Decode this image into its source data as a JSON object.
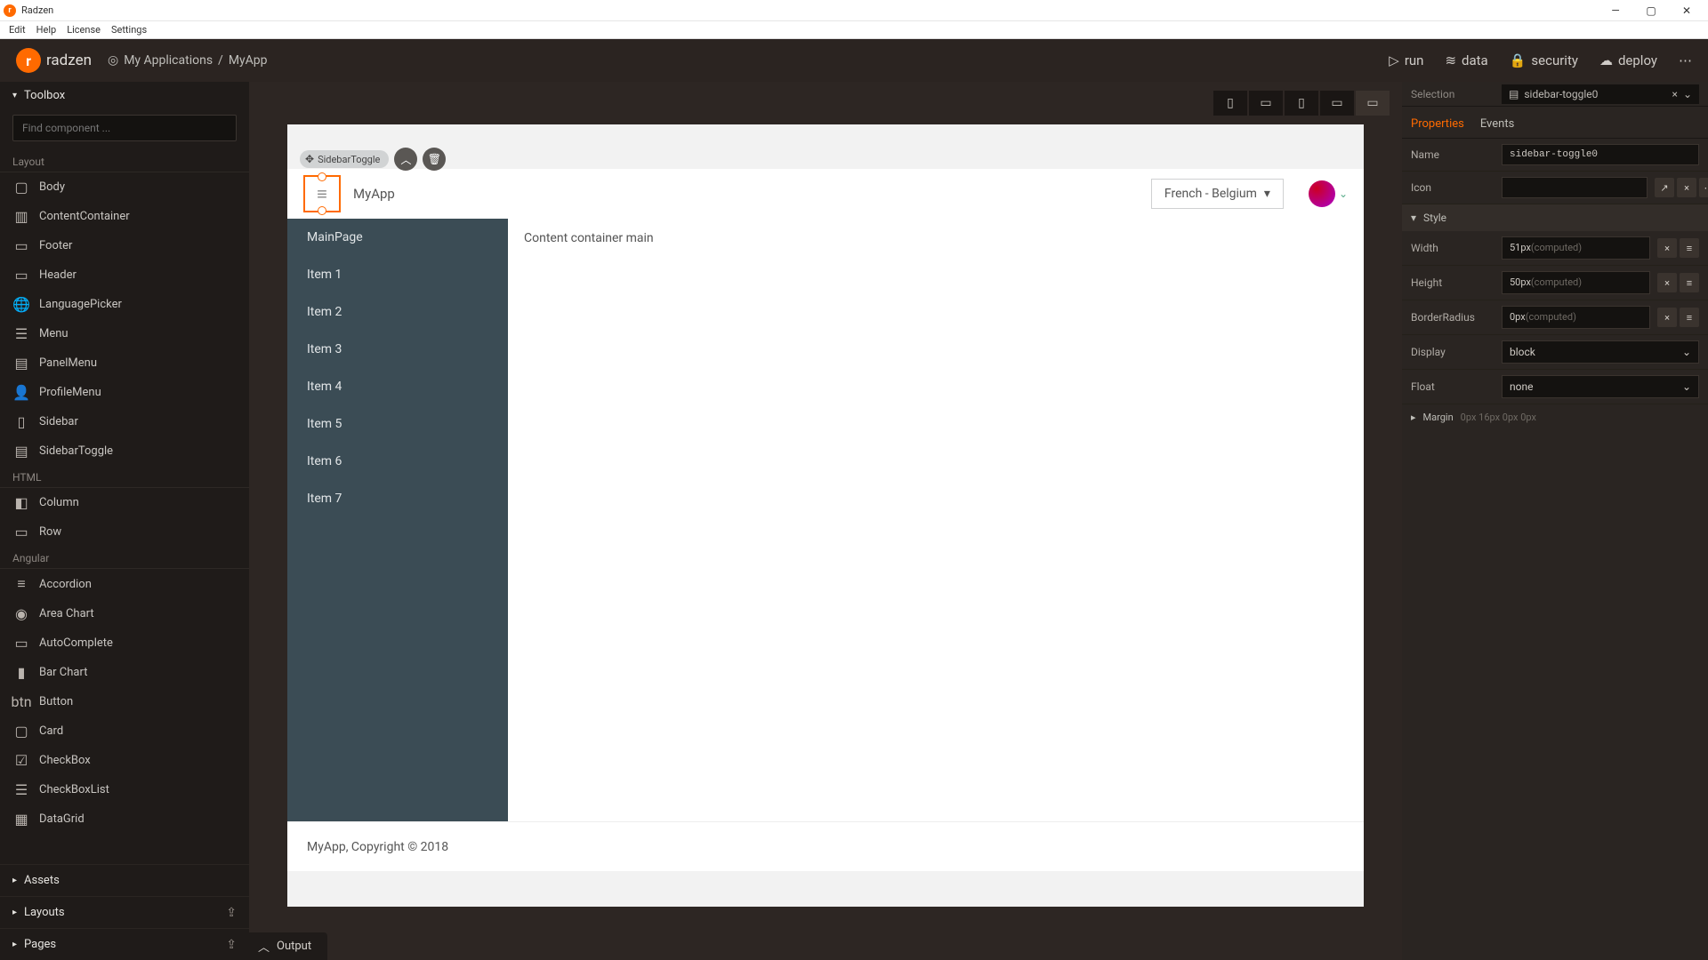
{
  "titlebar": {
    "title": "Radzen"
  },
  "menubar": {
    "items": [
      "Edit",
      "Help",
      "License",
      "Settings"
    ]
  },
  "header": {
    "brand": "radzen",
    "breadcrumb_root": "My Applications",
    "breadcrumb_current": "MyApp",
    "actions": {
      "run": "run",
      "data": "data",
      "security": "security",
      "deploy": "deploy"
    }
  },
  "toolbox": {
    "title": "Toolbox",
    "search_placeholder": "Find component ...",
    "groups": [
      {
        "label": "Layout",
        "items": [
          "Body",
          "ContentContainer",
          "Footer",
          "Header",
          "LanguagePicker",
          "Menu",
          "PanelMenu",
          "ProfileMenu",
          "Sidebar",
          "SidebarToggle"
        ]
      },
      {
        "label": "HTML",
        "items": [
          "Column",
          "Row"
        ]
      },
      {
        "label": "Angular",
        "items": [
          "Accordion",
          "Area Chart",
          "AutoComplete",
          "Bar Chart",
          "Button",
          "Card",
          "CheckBox",
          "CheckBoxList",
          "DataGrid"
        ]
      }
    ],
    "bottom": {
      "assets": "Assets",
      "layouts": "Layouts",
      "pages": "Pages"
    }
  },
  "canvas": {
    "selection_chip": "SidebarToggle",
    "preview": {
      "app_title": "MyApp",
      "language": "French - Belgium",
      "nav_items": [
        "MainPage",
        "Item 1",
        "Item 2",
        "Item 3",
        "Item 4",
        "Item 5",
        "Item 6",
        "Item 7"
      ],
      "content_text": "Content container main",
      "footer_text": "MyApp, Copyright © 2018"
    }
  },
  "output_tab": "Output",
  "properties": {
    "selection_label": "Selection",
    "selection_value": "sidebar-toggle0",
    "tabs": {
      "properties": "Properties",
      "events": "Events"
    },
    "name_label": "Name",
    "name_value": "sidebar-toggle0",
    "icon_label": "Icon",
    "style_label": "Style",
    "width_label": "Width",
    "width_value": "51px",
    "computed": "(computed)",
    "height_label": "Height",
    "height_value": "50px",
    "radius_label": "BorderRadius",
    "radius_value": "0px",
    "display_label": "Display",
    "display_value": "block",
    "float_label": "Float",
    "float_value": "none",
    "margin_label": "Margin",
    "margin_value": "0px  16px  0px  0px"
  }
}
